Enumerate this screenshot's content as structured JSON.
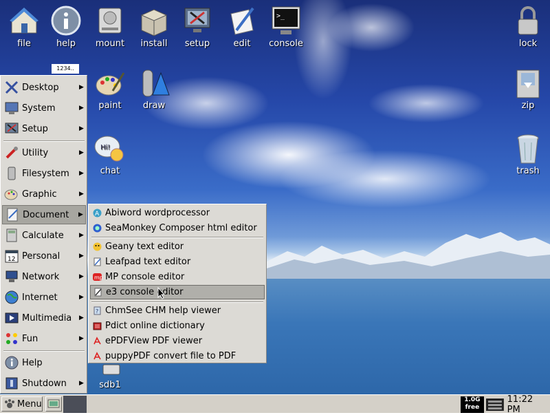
{
  "desktop": {
    "icons": {
      "file": "file",
      "help": "help",
      "mount": "mount",
      "install": "install",
      "setup": "setup",
      "edit": "edit",
      "console": "console",
      "lock": "lock",
      "paint": "paint",
      "draw": "draw",
      "zip": "zip",
      "chat": "chat",
      "trash": "trash",
      "sdb1": "sdb1",
      "partial_label": "1234.."
    }
  },
  "start_menu": {
    "items": [
      {
        "label": "Desktop",
        "icon": "desktop-x-icon"
      },
      {
        "label": "System",
        "icon": "system-monitor-icon"
      },
      {
        "label": "Setup",
        "icon": "setup-wizard-icon"
      },
      {
        "label": "Utility",
        "icon": "utility-tools-icon"
      },
      {
        "label": "Filesystem",
        "icon": "filesystem-icon"
      },
      {
        "label": "Graphic",
        "icon": "graphic-palette-icon"
      },
      {
        "label": "Document",
        "icon": "document-icon"
      },
      {
        "label": "Calculate",
        "icon": "calculator-icon"
      },
      {
        "label": "Personal",
        "icon": "calendar-icon"
      },
      {
        "label": "Network",
        "icon": "network-icon"
      },
      {
        "label": "Internet",
        "icon": "globe-icon"
      },
      {
        "label": "Multimedia",
        "icon": "multimedia-icon"
      },
      {
        "label": "Fun",
        "icon": "fun-icon"
      },
      {
        "label": "Help",
        "icon": "help-icon"
      },
      {
        "label": "Shutdown",
        "icon": "shutdown-icon"
      }
    ],
    "active": "Document"
  },
  "document_submenu": {
    "items": [
      {
        "label": "Abiword wordprocessor"
      },
      {
        "label": "SeaMonkey Composer html editor"
      },
      {
        "label": "Geany text editor"
      },
      {
        "label": "Leafpad text editor"
      },
      {
        "label": "MP console editor"
      },
      {
        "label": "e3 console editor"
      },
      {
        "label": "ChmSee CHM help viewer"
      },
      {
        "label": "Pdict online dictionary"
      },
      {
        "label": "ePDFView PDF viewer"
      },
      {
        "label": "puppyPDF convert file to PDF"
      }
    ],
    "active": "e3 console editor"
  },
  "taskbar": {
    "menu_label": "Menu",
    "badge_line1": "1.0G",
    "badge_line2": "free",
    "clock": "11:22 PM"
  },
  "colors": {
    "menu_bg": "#dcdad5",
    "active_item": "#a7a6a0",
    "taskbar_bg": "#d4d0c8"
  }
}
